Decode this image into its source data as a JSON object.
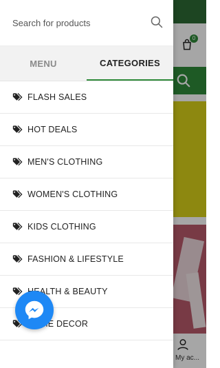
{
  "search": {
    "placeholder": "Search for products"
  },
  "tabs": [
    {
      "label": "MENU",
      "active": false
    },
    {
      "label": "CATEGORIES",
      "active": true
    }
  ],
  "categories": [
    {
      "label": "FLASH SALES"
    },
    {
      "label": "HOT DEALS"
    },
    {
      "label": "MEN'S CLOTHING"
    },
    {
      "label": "WOMEN'S CLOTHING"
    },
    {
      "label": "KIDS CLOTHING"
    },
    {
      "label": "FASHION & LIFESTYLE"
    },
    {
      "label": "HEALTH & BEAUTY"
    },
    {
      "label": "HOME DECOR"
    }
  ],
  "background": {
    "cart_count": "0",
    "account_label": "My ac..."
  },
  "colors": {
    "accent": "#2f8a3a",
    "messenger": "#1e88f5"
  },
  "icons": {
    "search": "search-icon",
    "category_tag": "tag-icon",
    "cart": "cart-icon",
    "account": "account-icon",
    "messenger": "messenger-icon"
  }
}
